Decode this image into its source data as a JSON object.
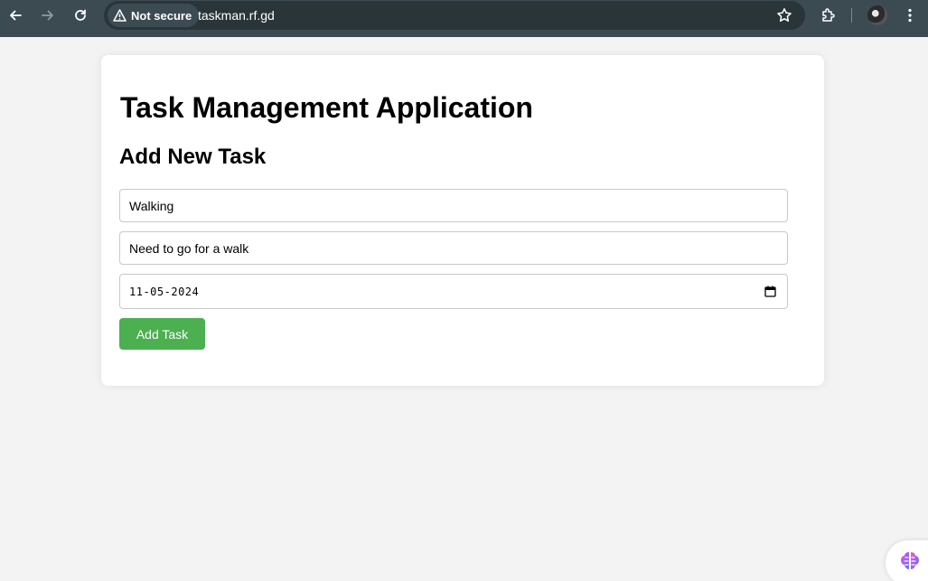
{
  "browser": {
    "security_label": "Not secure",
    "url": "taskman.rf.gd"
  },
  "app": {
    "title": "Task Management Application",
    "section_title": "Add New Task"
  },
  "form": {
    "title_value": "Walking",
    "description_value": "Need to go for a walk",
    "date_value": "11-05-2024",
    "submit_label": "Add Task"
  },
  "colors": {
    "toolbar": "#3c4b52",
    "submit": "#4caf50"
  }
}
